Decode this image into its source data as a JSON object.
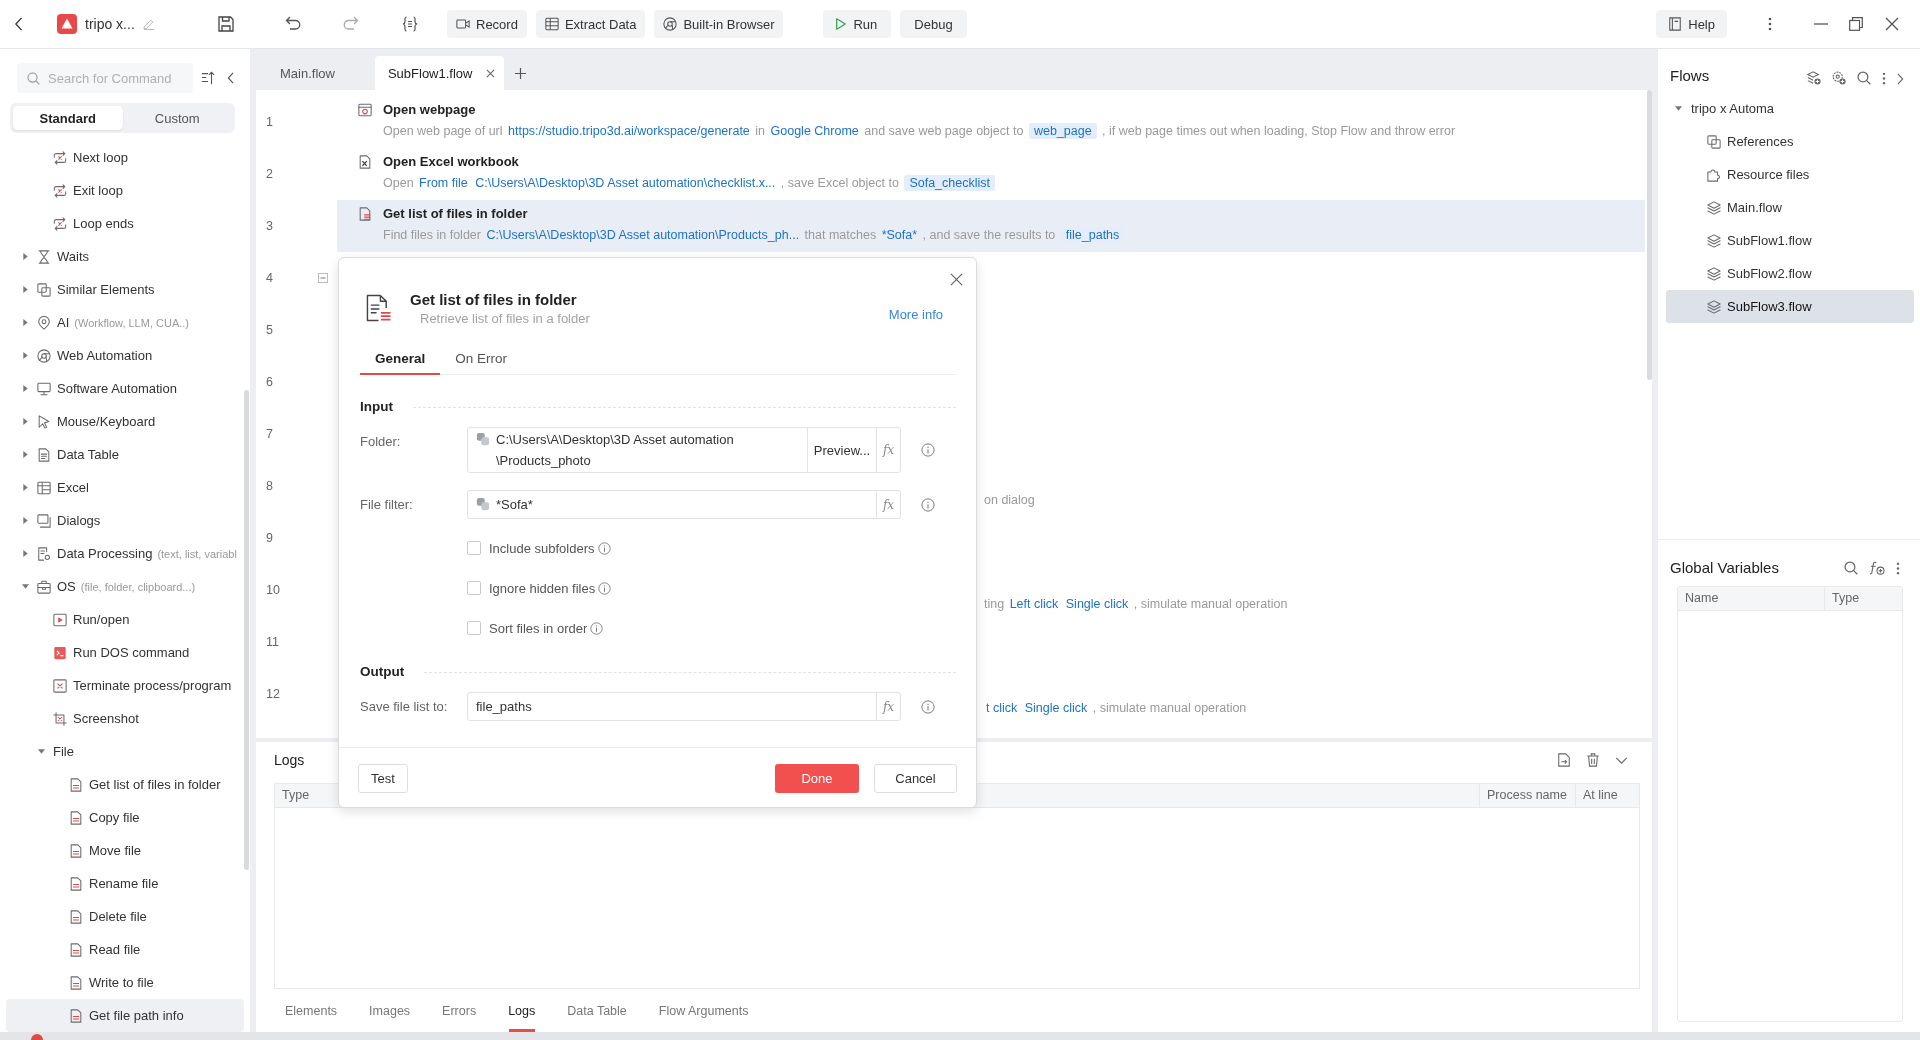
{
  "title_bar": {
    "app_name": "tripo x...",
    "toolbar_buttons": [
      {
        "kind": "record",
        "label": "Record"
      },
      {
        "kind": "extract",
        "label": "Extract Data"
      },
      {
        "kind": "browser",
        "label": "Built-in Browser"
      }
    ],
    "run_buttons": [
      {
        "kind": "run",
        "label": "Run"
      },
      {
        "kind": "debug",
        "label": "Debug"
      }
    ],
    "help_button": "Help"
  },
  "sidebar": {
    "search": {
      "placeholder": "Search for Command"
    },
    "modes": [
      {
        "label": "Standard",
        "selected": true
      },
      {
        "label": "Custom",
        "selected": false
      }
    ],
    "continued_items": [
      {
        "label": "Next loop",
        "kind": "loop",
        "selected": false
      },
      {
        "label": "Exit loop",
        "kind": "loop",
        "selected": false
      },
      {
        "label": "Loop ends",
        "kind": "loop",
        "selected": false
      }
    ],
    "groups": [
      {
        "label": "Waits",
        "kind": "waits",
        "expanded": false,
        "selected": false
      },
      {
        "label": "Similar Elements",
        "kind": "similar",
        "expanded": false,
        "selected": false
      },
      {
        "label": "AI",
        "hint": "(Workflow, LLM, CUA..)",
        "kind": "ai",
        "expanded": false,
        "selected": false
      },
      {
        "label": "Web Automation",
        "kind": "web",
        "expanded": false,
        "selected": false
      },
      {
        "label": "Software Automation",
        "kind": "software",
        "expanded": false,
        "selected": false
      },
      {
        "label": "Mouse/Keyboard",
        "kind": "mouse",
        "expanded": false,
        "selected": false
      },
      {
        "label": "Data Table",
        "kind": "table",
        "expanded": false,
        "selected": false
      },
      {
        "label": "Excel",
        "kind": "excel",
        "expanded": false,
        "selected": false
      },
      {
        "label": "Dialogs",
        "kind": "dialogs",
        "expanded": false,
        "selected": false
      },
      {
        "label": "Data Processing",
        "hint": "(text, list, variabl",
        "kind": "data",
        "expanded": false,
        "selected": false
      },
      {
        "label": "OS",
        "hint": "(file, folder, clipboard...)",
        "kind": "os",
        "expanded": true,
        "selected": false,
        "children": [
          {
            "label": "Run/open",
            "kind": "run",
            "selected": false
          },
          {
            "label": "Run DOS command",
            "kind": "dos",
            "selected": false
          },
          {
            "label": "Terminate process/program",
            "kind": "terminate",
            "selected": false
          },
          {
            "label": "Screenshot",
            "kind": "screenshot",
            "selected": false
          },
          {
            "label": "File",
            "kind": "plain",
            "expanded": true,
            "selected": false,
            "children": [
              {
                "label": "Get list of files in folder",
                "kind": "file",
                "selected": false
              },
              {
                "label": "Copy file",
                "kind": "file",
                "selected": false
              },
              {
                "label": "Move file",
                "kind": "file",
                "selected": false
              },
              {
                "label": "Rename file",
                "kind": "file",
                "selected": false
              },
              {
                "label": "Delete file",
                "kind": "file",
                "selected": false
              },
              {
                "label": "Read file",
                "kind": "file",
                "selected": false
              },
              {
                "label": "Write to file",
                "kind": "file",
                "selected": false
              },
              {
                "label": "Get file path info",
                "kind": "file",
                "selected": true
              }
            ]
          }
        ]
      }
    ]
  },
  "editor": {
    "tabs": [
      {
        "label": "Main.flow",
        "selected": false
      },
      {
        "label": "SubFlow1.flow",
        "selected": true
      }
    ],
    "steps": [
      {
        "line": "1",
        "kind": "webpage",
        "title": "Open webpage",
        "selected": false,
        "parts": [
          {
            "kind": "text",
            "text": "Open web page of url"
          },
          {
            "kind": "value",
            "text": "https://studio.tripo3d.ai/workspace/generate"
          },
          {
            "kind": "text",
            "text": "in"
          },
          {
            "kind": "value",
            "text": "Google Chrome"
          },
          {
            "kind": "text",
            "text": "and save web page object to"
          },
          {
            "kind": "variable",
            "text": "web_page"
          },
          {
            "kind": "text",
            "text": ", if web page times out when loading, Stop Flow and throw error"
          }
        ]
      },
      {
        "line": "2",
        "kind": "excelfile",
        "title": "Open Excel workbook",
        "selected": false,
        "parts": [
          {
            "kind": "text",
            "text": "Open"
          },
          {
            "kind": "value",
            "text": "From file"
          },
          {
            "kind": "value",
            "text": "C:\\Users\\A\\Desktop\\3D Asset automation\\checklist.x..."
          },
          {
            "kind": "text",
            "text": ", save Excel object to"
          },
          {
            "kind": "variable",
            "text": "Sofa_checklist"
          }
        ]
      },
      {
        "line": "3",
        "kind": "filelist",
        "title": "Get list of files in folder",
        "selected": true,
        "parts": [
          {
            "kind": "text",
            "text": "Find files in folder"
          },
          {
            "kind": "value",
            "text": "C:\\Users\\A\\Desktop\\3D Asset automation\\Products_ph..."
          },
          {
            "kind": "text",
            "text": "that matches"
          },
          {
            "kind": "value",
            "text": "*Sofa*"
          },
          {
            "kind": "text",
            "text": ", and save the results to"
          },
          {
            "kind": "variable",
            "text": "file_paths"
          }
        ]
      },
      {
        "line": "4",
        "fold": {
          "expanded": true
        },
        "selected": false
      },
      {
        "line": "5",
        "selected": false
      },
      {
        "line": "6",
        "selected": false
      },
      {
        "line": "7",
        "selected": false
      },
      {
        "line": "8",
        "selected": false,
        "parts": [
          {
            "kind": "text",
            "text": "on dialog"
          }
        ]
      },
      {
        "line": "9",
        "selected": false
      },
      {
        "line": "10",
        "selected": false,
        "parts": [
          {
            "kind": "text",
            "text": "ting"
          },
          {
            "kind": "value",
            "text": "Left click"
          },
          {
            "kind": "value",
            "text": "Single click"
          },
          {
            "kind": "text",
            "text": ", simulate manual operation"
          }
        ]
      },
      {
        "line": "11",
        "selected": false
      },
      {
        "line": "12",
        "selected": false,
        "parts": [
          {
            "kind": "value",
            "text": "t click"
          },
          {
            "kind": "value",
            "text": "Single click"
          },
          {
            "kind": "text",
            "text": ", simulate manual operation"
          }
        ]
      }
    ]
  },
  "logs_panel": {
    "title": "Logs",
    "columns": [
      "Type",
      "Process name",
      "At line"
    ],
    "tabs": [
      {
        "label": "Elements",
        "selected": false
      },
      {
        "label": "Images",
        "selected": false
      },
      {
        "label": "Errors",
        "selected": false
      },
      {
        "label": "Logs",
        "selected": true
      },
      {
        "label": "Data Table",
        "selected": false
      },
      {
        "label": "Flow Arguments",
        "selected": false
      }
    ]
  },
  "flows_panel": {
    "title": "Flows",
    "tree": [
      {
        "label": "tripo x Automa",
        "expanded": true,
        "selected": false,
        "children": [
          {
            "label": "References",
            "kind": "references",
            "selected": false
          },
          {
            "label": "Resource files",
            "kind": "resources",
            "selected": false
          },
          {
            "label": "Main.flow",
            "kind": "flow",
            "selected": false
          },
          {
            "label": "SubFlow1.flow",
            "kind": "flow",
            "selected": false
          },
          {
            "label": "SubFlow2.flow",
            "kind": "flow",
            "selected": false
          },
          {
            "label": "SubFlow3.flow",
            "kind": "flow",
            "selected": true
          }
        ]
      }
    ]
  },
  "global_variables": {
    "title": "Global Variables",
    "columns": [
      "Name",
      "Type"
    ]
  },
  "dialog": {
    "title": "Get list of files in folder",
    "subtitle": "Retrieve list of files in a folder",
    "more_info": "More info",
    "tabs": [
      {
        "label": "General",
        "selected": true
      },
      {
        "label": "On Error",
        "selected": false
      }
    ],
    "sections": [
      {
        "title": "Input",
        "items": [
          {
            "kind": "field",
            "label": "Folder:",
            "expression": true,
            "value_lines": [
              "C:\\Users\\A\\Desktop\\3D Asset automation",
              "\\Products_photo"
            ],
            "action": "Preview...",
            "fx": "fx"
          },
          {
            "kind": "field",
            "label": "File filter:",
            "expression": true,
            "value_lines": [
              "*Sofa*"
            ],
            "fx": "fx"
          },
          {
            "kind": "checkbox",
            "label": "Include subfolders",
            "checked": false
          },
          {
            "kind": "checkbox",
            "label": "Ignore hidden files",
            "checked": false
          },
          {
            "kind": "checkbox",
            "label": "Sort files in order",
            "checked": false
          }
        ]
      },
      {
        "title": "Output",
        "items": [
          {
            "kind": "field",
            "label": "Save file list to:",
            "expression": false,
            "value_lines": [
              "file_paths"
            ],
            "fx": "fx"
          }
        ]
      }
    ],
    "buttons": [
      {
        "kind": "test",
        "label": "Test"
      },
      {
        "kind": "primary",
        "label": "Done"
      },
      {
        "kind": "secondary",
        "label": "Cancel"
      }
    ]
  }
}
